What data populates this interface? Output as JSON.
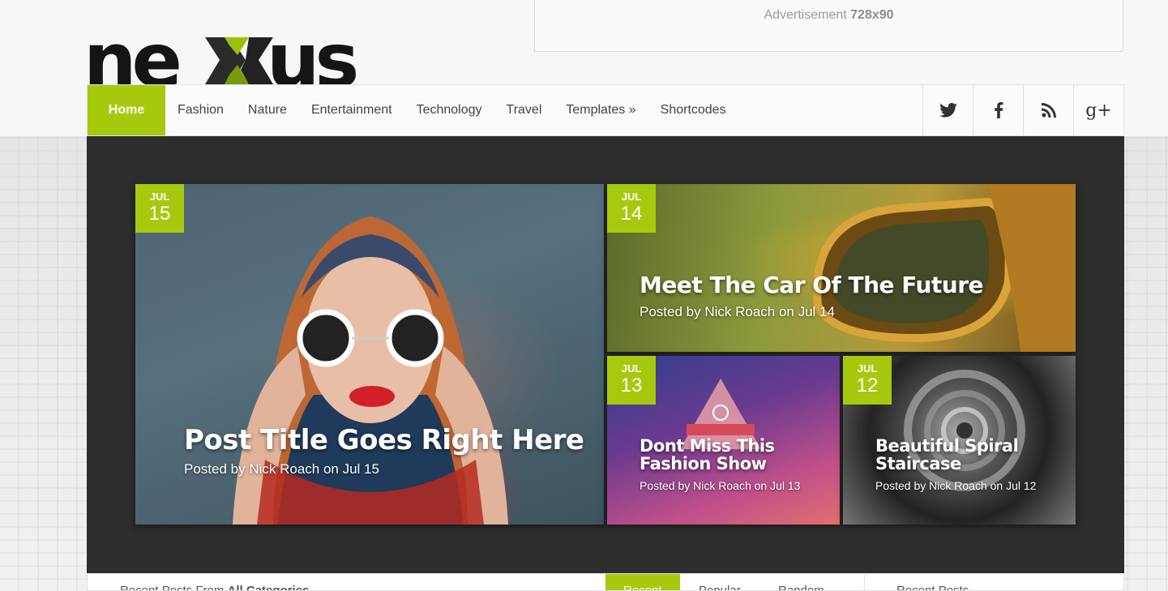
{
  "logo": {
    "text": "nexus"
  },
  "ad": {
    "label": "Advertisement",
    "size": "728x90"
  },
  "nav": {
    "items": [
      {
        "label": "Home",
        "active": true
      },
      {
        "label": "Fashion"
      },
      {
        "label": "Nature"
      },
      {
        "label": "Entertainment"
      },
      {
        "label": "Technology"
      },
      {
        "label": "Travel"
      },
      {
        "label": "Templates »"
      },
      {
        "label": "Shortcodes"
      }
    ],
    "social": [
      {
        "icon": "twitter-icon"
      },
      {
        "icon": "facebook-icon"
      },
      {
        "icon": "rss-icon"
      },
      {
        "icon": "google-plus-icon",
        "label": "g+"
      }
    ]
  },
  "slider": {
    "posts": [
      {
        "month": "JUL",
        "day": "15",
        "title": "Post Title Goes Right Here",
        "meta": "Posted by Nick Roach on Jul 15"
      },
      {
        "month": "JUL",
        "day": "14",
        "title": "Meet The Car Of The Future",
        "meta": "Posted by Nick Roach on Jul 14"
      },
      {
        "month": "JUL",
        "day": "13",
        "title": "Dont Miss This Fashion Show",
        "meta": "Posted by Nick Roach on Jul 13"
      },
      {
        "month": "JUL",
        "day": "12",
        "title": "Beautiful Spiral Staircase",
        "meta": "Posted by Nick Roach on Jul 12"
      }
    ]
  },
  "bottom": {
    "recent_prefix": "Recent Posts From",
    "recent_bold": "All Categories",
    "tabs": [
      "Recent",
      "Popular",
      "Random"
    ],
    "sidebar_title": "Recent Posts"
  },
  "colors": {
    "accent": "#a6c90e",
    "slider_bg": "#2d2d2d"
  }
}
